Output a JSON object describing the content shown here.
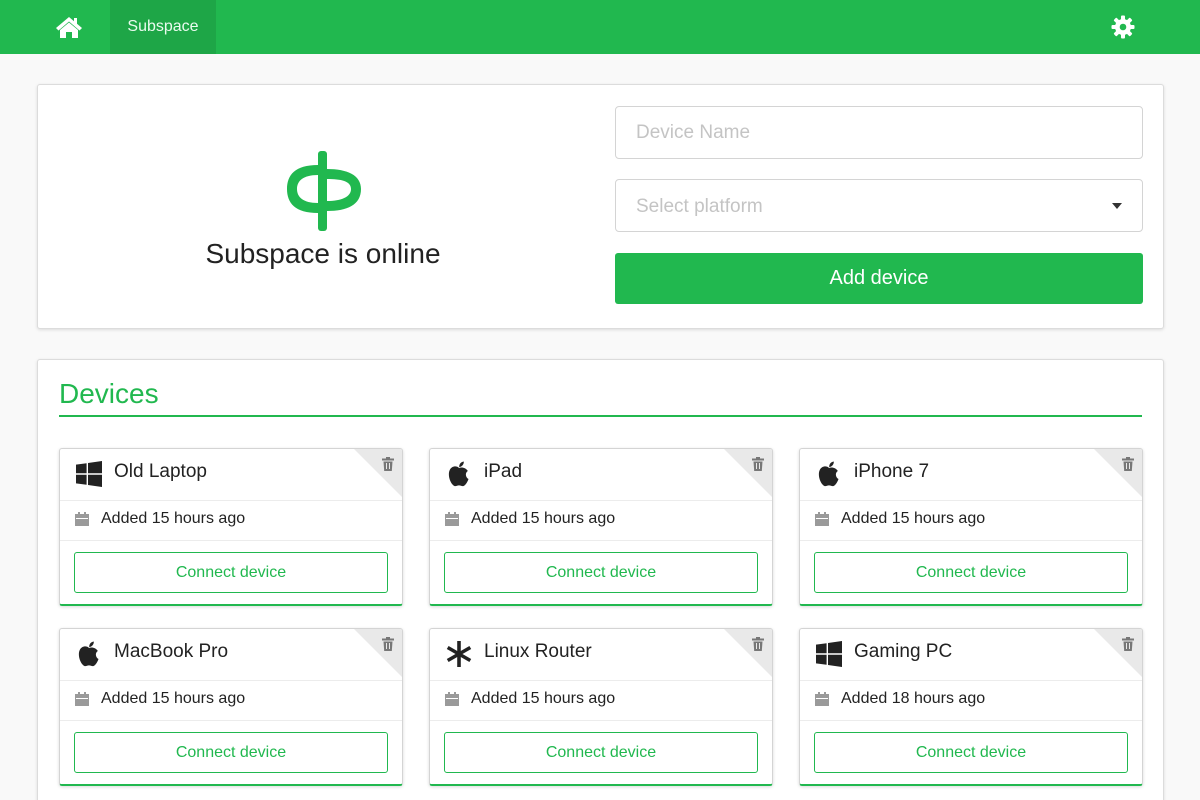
{
  "nav": {
    "home_icon": "home-icon",
    "brand": "Subspace",
    "settings_icon": "gear-icon"
  },
  "top": {
    "status": "Subspace is online",
    "device_name_placeholder": "Device Name",
    "platform_placeholder": "Select platform",
    "add_button": "Add device"
  },
  "devices": {
    "title": "Devices",
    "items": [
      {
        "name": "Old Laptop",
        "platform_icon": "windows-icon",
        "added": "Added 15 hours ago",
        "connect": "Connect device"
      },
      {
        "name": "iPad",
        "platform_icon": "apple-icon",
        "added": "Added 15 hours ago",
        "connect": "Connect device"
      },
      {
        "name": "iPhone 7",
        "platform_icon": "apple-icon",
        "added": "Added 15 hours ago",
        "connect": "Connect device"
      },
      {
        "name": "MacBook Pro",
        "platform_icon": "apple-icon",
        "added": "Added 15 hours ago",
        "connect": "Connect device"
      },
      {
        "name": "Linux Router",
        "platform_icon": "asterisk-icon",
        "added": "Added 15 hours ago",
        "connect": "Connect device"
      },
      {
        "name": "Gaming PC",
        "platform_icon": "windows-icon",
        "added": "Added 18 hours ago",
        "connect": "Connect device"
      }
    ]
  },
  "colors": {
    "accent": "#21b84f",
    "accent_dark": "#1ea647",
    "text": "#222222",
    "muted_icon": "#9a9a9a"
  }
}
